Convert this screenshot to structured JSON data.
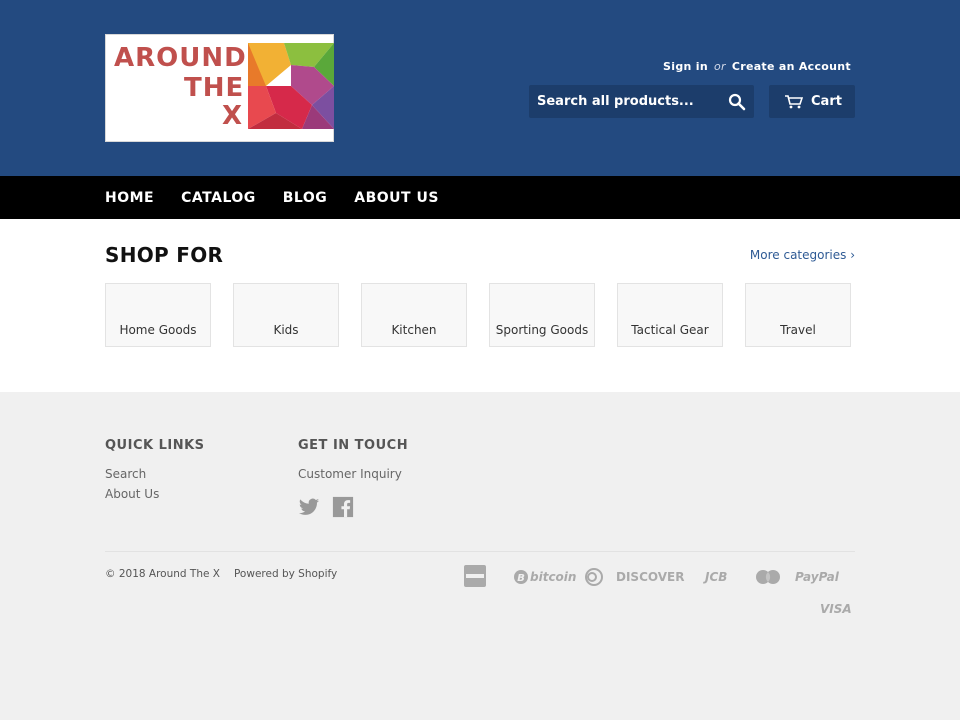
{
  "header": {
    "logo": {
      "line1": "AROUND",
      "line2": "THE",
      "line3": "X"
    },
    "account": {
      "sign_in": "Sign in",
      "or": "or",
      "create": "Create an Account"
    },
    "search": {
      "placeholder": "Search all products..."
    },
    "cart": {
      "label": "Cart"
    },
    "colors": {
      "bg": "#234a80",
      "search_bg": "#1c3d6b",
      "logo_text": "#c0504d"
    }
  },
  "nav": {
    "items": [
      {
        "label": "HOME"
      },
      {
        "label": "CATALOG"
      },
      {
        "label": "BLOG"
      },
      {
        "label": "ABOUT US"
      }
    ]
  },
  "main": {
    "title": "SHOP FOR",
    "more_link": "More categories ›",
    "categories": [
      {
        "label": "Home Goods"
      },
      {
        "label": "Kids"
      },
      {
        "label": "Kitchen"
      },
      {
        "label": "Sporting Goods"
      },
      {
        "label": "Tactical Gear"
      },
      {
        "label": "Travel"
      }
    ]
  },
  "footer": {
    "quick_links": {
      "title": "QUICK LINKS",
      "items": [
        "Search",
        "About Us"
      ]
    },
    "get_in_touch": {
      "title": "GET IN TOUCH",
      "items": [
        "Customer Inquiry"
      ],
      "social_icons": [
        "twitter-icon",
        "facebook-icon"
      ]
    },
    "copyright": "© 2018 Around The X",
    "powered": "Powered by Shopify",
    "payment_icons": [
      "american-express-icon",
      "bitcoin-icon",
      "diners-club-icon",
      "discover-icon",
      "jcb-icon",
      "master-icon",
      "paypal-icon",
      "visa-icon"
    ],
    "payment_labels": {
      "bitcoin": "bitcoin",
      "discover": "DISCOVER",
      "jcb": "JCB",
      "paypal": "PayPal",
      "visa": "VISA"
    }
  }
}
